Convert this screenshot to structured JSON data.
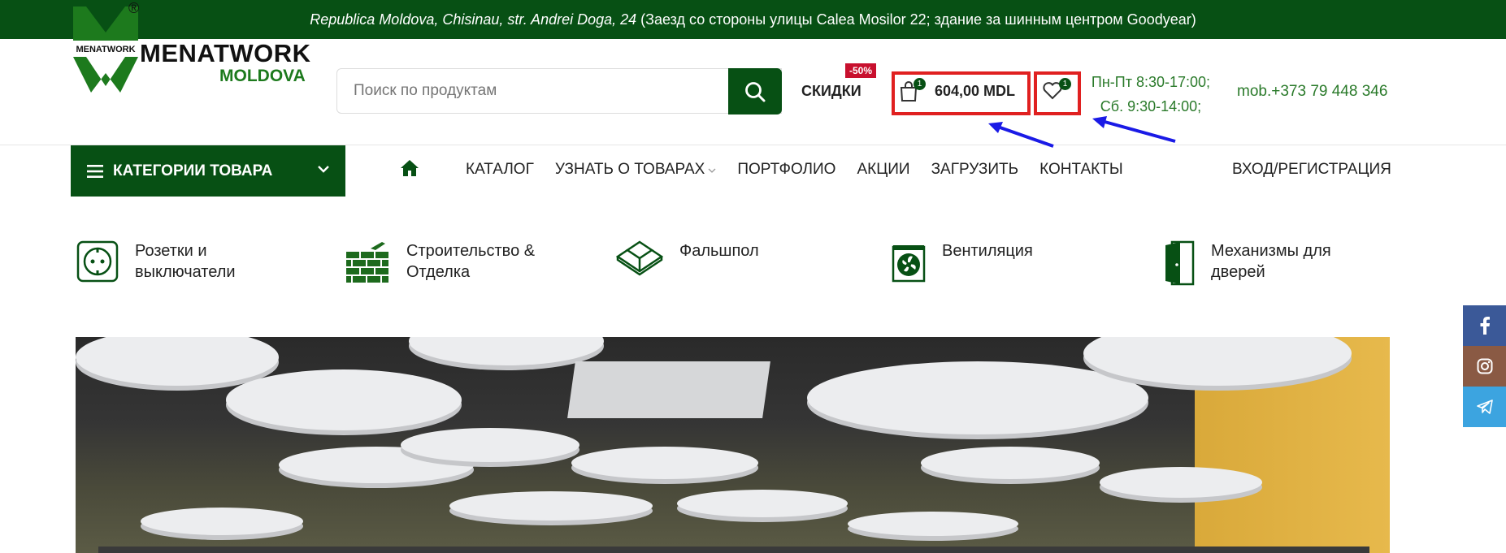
{
  "topbar": {
    "address_italic": "Republica Moldova, Chisinau, str. Andrei Doga, 24",
    "address_note": "(Заезд со стороны улицы Calea Mosilor 22; здание за шинным центром Goodyear)"
  },
  "brand": {
    "name": "MENATWORK",
    "sub": "MOLDOVA",
    "logo_text": "MENATWORK",
    "registered": "®"
  },
  "search": {
    "placeholder": "Поиск по продуктам"
  },
  "header": {
    "discounts_label": "СКИДКИ",
    "sale_badge": "-50%",
    "cart_count": "1",
    "cart_total": "604,00 MDL",
    "wishlist_count": "1",
    "hours_line1": "Пн-Пт 8:30-17:00;",
    "hours_line2": "Сб. 9:30-14:00;",
    "phone": "mob.+373 79 448 346"
  },
  "nav": {
    "categories_label": "КАТЕГОРИИ ТОВАРА",
    "items": [
      "КАТАЛОГ",
      "УЗНАТЬ О ТОВАРАХ",
      "ПОРТФОЛИО",
      "АКЦИИ",
      "ЗАГРУЗИТЬ",
      "КОНТАКТЫ"
    ],
    "login": "ВХОД/РЕГИСТРАЦИЯ"
  },
  "categories": [
    {
      "line1": "Розетки и",
      "line2": "выключатели",
      "icon": "socket-icon"
    },
    {
      "line1": "Строительство &",
      "line2": "Отделка",
      "icon": "brick-wall-icon"
    },
    {
      "line1": "Фальшпол",
      "line2": "",
      "icon": "floor-tiles-icon"
    },
    {
      "line1": "Вентиляция",
      "line2": "",
      "icon": "fan-icon"
    },
    {
      "line1": "Механизмы для",
      "line2": "дверей",
      "icon": "door-icon"
    }
  ],
  "colors": {
    "brand_green": "#075014",
    "highlight_red": "#e02020",
    "arrow_blue": "#1a1ae6"
  }
}
